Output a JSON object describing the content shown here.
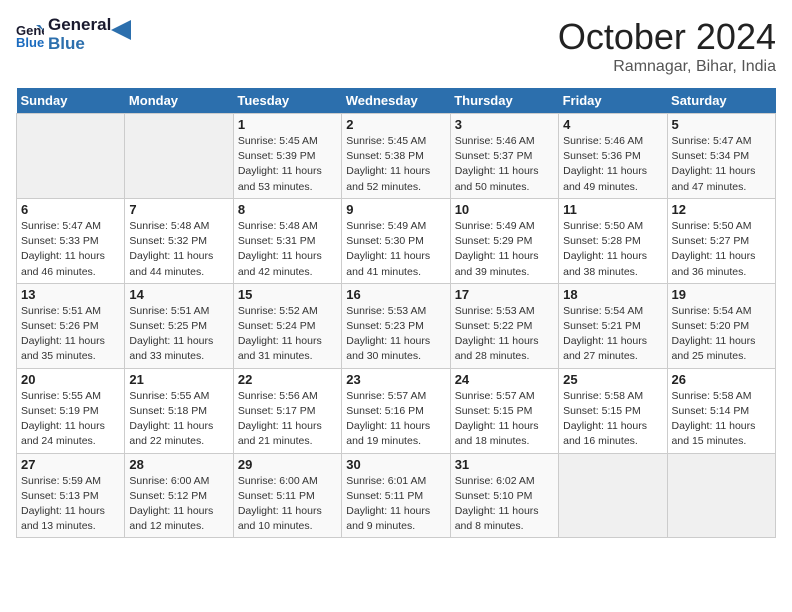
{
  "header": {
    "logo_line1": "General",
    "logo_line2": "Blue",
    "month": "October 2024",
    "location": "Ramnagar, Bihar, India"
  },
  "weekdays": [
    "Sunday",
    "Monday",
    "Tuesday",
    "Wednesday",
    "Thursday",
    "Friday",
    "Saturday"
  ],
  "weeks": [
    [
      {
        "day": "",
        "info": ""
      },
      {
        "day": "",
        "info": ""
      },
      {
        "day": "1",
        "info": "Sunrise: 5:45 AM\nSunset: 5:39 PM\nDaylight: 11 hours\nand 53 minutes."
      },
      {
        "day": "2",
        "info": "Sunrise: 5:45 AM\nSunset: 5:38 PM\nDaylight: 11 hours\nand 52 minutes."
      },
      {
        "day": "3",
        "info": "Sunrise: 5:46 AM\nSunset: 5:37 PM\nDaylight: 11 hours\nand 50 minutes."
      },
      {
        "day": "4",
        "info": "Sunrise: 5:46 AM\nSunset: 5:36 PM\nDaylight: 11 hours\nand 49 minutes."
      },
      {
        "day": "5",
        "info": "Sunrise: 5:47 AM\nSunset: 5:34 PM\nDaylight: 11 hours\nand 47 minutes."
      }
    ],
    [
      {
        "day": "6",
        "info": "Sunrise: 5:47 AM\nSunset: 5:33 PM\nDaylight: 11 hours\nand 46 minutes."
      },
      {
        "day": "7",
        "info": "Sunrise: 5:48 AM\nSunset: 5:32 PM\nDaylight: 11 hours\nand 44 minutes."
      },
      {
        "day": "8",
        "info": "Sunrise: 5:48 AM\nSunset: 5:31 PM\nDaylight: 11 hours\nand 42 minutes."
      },
      {
        "day": "9",
        "info": "Sunrise: 5:49 AM\nSunset: 5:30 PM\nDaylight: 11 hours\nand 41 minutes."
      },
      {
        "day": "10",
        "info": "Sunrise: 5:49 AM\nSunset: 5:29 PM\nDaylight: 11 hours\nand 39 minutes."
      },
      {
        "day": "11",
        "info": "Sunrise: 5:50 AM\nSunset: 5:28 PM\nDaylight: 11 hours\nand 38 minutes."
      },
      {
        "day": "12",
        "info": "Sunrise: 5:50 AM\nSunset: 5:27 PM\nDaylight: 11 hours\nand 36 minutes."
      }
    ],
    [
      {
        "day": "13",
        "info": "Sunrise: 5:51 AM\nSunset: 5:26 PM\nDaylight: 11 hours\nand 35 minutes."
      },
      {
        "day": "14",
        "info": "Sunrise: 5:51 AM\nSunset: 5:25 PM\nDaylight: 11 hours\nand 33 minutes."
      },
      {
        "day": "15",
        "info": "Sunrise: 5:52 AM\nSunset: 5:24 PM\nDaylight: 11 hours\nand 31 minutes."
      },
      {
        "day": "16",
        "info": "Sunrise: 5:53 AM\nSunset: 5:23 PM\nDaylight: 11 hours\nand 30 minutes."
      },
      {
        "day": "17",
        "info": "Sunrise: 5:53 AM\nSunset: 5:22 PM\nDaylight: 11 hours\nand 28 minutes."
      },
      {
        "day": "18",
        "info": "Sunrise: 5:54 AM\nSunset: 5:21 PM\nDaylight: 11 hours\nand 27 minutes."
      },
      {
        "day": "19",
        "info": "Sunrise: 5:54 AM\nSunset: 5:20 PM\nDaylight: 11 hours\nand 25 minutes."
      }
    ],
    [
      {
        "day": "20",
        "info": "Sunrise: 5:55 AM\nSunset: 5:19 PM\nDaylight: 11 hours\nand 24 minutes."
      },
      {
        "day": "21",
        "info": "Sunrise: 5:55 AM\nSunset: 5:18 PM\nDaylight: 11 hours\nand 22 minutes."
      },
      {
        "day": "22",
        "info": "Sunrise: 5:56 AM\nSunset: 5:17 PM\nDaylight: 11 hours\nand 21 minutes."
      },
      {
        "day": "23",
        "info": "Sunrise: 5:57 AM\nSunset: 5:16 PM\nDaylight: 11 hours\nand 19 minutes."
      },
      {
        "day": "24",
        "info": "Sunrise: 5:57 AM\nSunset: 5:15 PM\nDaylight: 11 hours\nand 18 minutes."
      },
      {
        "day": "25",
        "info": "Sunrise: 5:58 AM\nSunset: 5:15 PM\nDaylight: 11 hours\nand 16 minutes."
      },
      {
        "day": "26",
        "info": "Sunrise: 5:58 AM\nSunset: 5:14 PM\nDaylight: 11 hours\nand 15 minutes."
      }
    ],
    [
      {
        "day": "27",
        "info": "Sunrise: 5:59 AM\nSunset: 5:13 PM\nDaylight: 11 hours\nand 13 minutes."
      },
      {
        "day": "28",
        "info": "Sunrise: 6:00 AM\nSunset: 5:12 PM\nDaylight: 11 hours\nand 12 minutes."
      },
      {
        "day": "29",
        "info": "Sunrise: 6:00 AM\nSunset: 5:11 PM\nDaylight: 11 hours\nand 10 minutes."
      },
      {
        "day": "30",
        "info": "Sunrise: 6:01 AM\nSunset: 5:11 PM\nDaylight: 11 hours\nand 9 minutes."
      },
      {
        "day": "31",
        "info": "Sunrise: 6:02 AM\nSunset: 5:10 PM\nDaylight: 11 hours\nand 8 minutes."
      },
      {
        "day": "",
        "info": ""
      },
      {
        "day": "",
        "info": ""
      }
    ]
  ]
}
